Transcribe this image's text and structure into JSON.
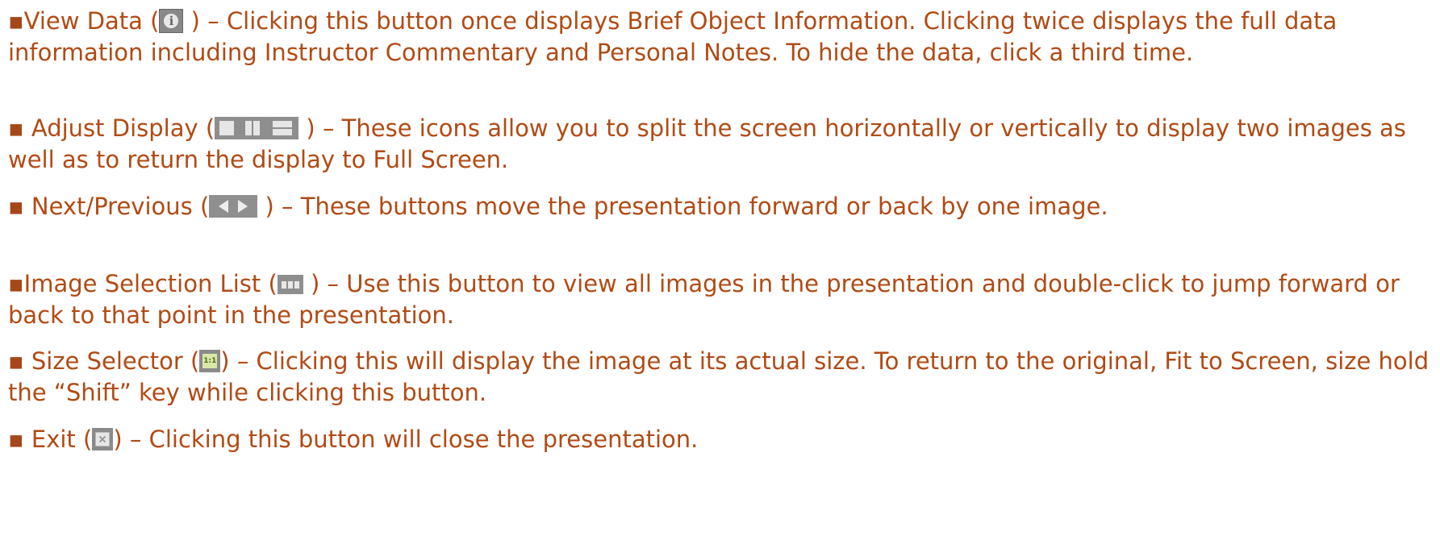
{
  "items": [
    {
      "bullet": "▪",
      "pre": "View Data (",
      "post": " ) – Clicking this button once displays Brief Object Information.  Clicking twice displays the full data information including Instructor Commentary and Personal Notes.  To hide the data, click a third time.",
      "icon": "info-icon",
      "icon_glyph": "i"
    },
    {
      "bullet": "▪",
      "pre": " Adjust Display (",
      "post": " ) – These icons allow you to split the screen horizontally or vertically to display two images as well as to return the display to Full Screen.",
      "icon": "adjust-display-icons"
    },
    {
      "bullet": "▪",
      "pre": " Next/Previous (",
      "post": " ) – These buttons move the presentation forward or back by one image.",
      "icon": "next-previous-icons"
    },
    {
      "bullet": "▪",
      "pre": "Image Selection List  (",
      "post": " ) – Use this button to view all images in the presentation and double-click to jump forward or back to that point in the presentation.",
      "icon": "image-list-icon"
    },
    {
      "bullet": "▪",
      "pre": " Size Selector (",
      "post": ") – Clicking this will display the image at its actual size.  To return to the original, Fit to Screen, size hold the “Shift” key while clicking this button.",
      "icon": "size-selector-icon",
      "icon_glyph": "1:1"
    },
    {
      "bullet": "▪",
      "pre": " Exit (",
      "post": ") – Clicking this button will close the presentation.",
      "icon": "exit-icon"
    }
  ],
  "colors": {
    "text": "#b14a14",
    "icon_bg": "#8e8e8e"
  }
}
